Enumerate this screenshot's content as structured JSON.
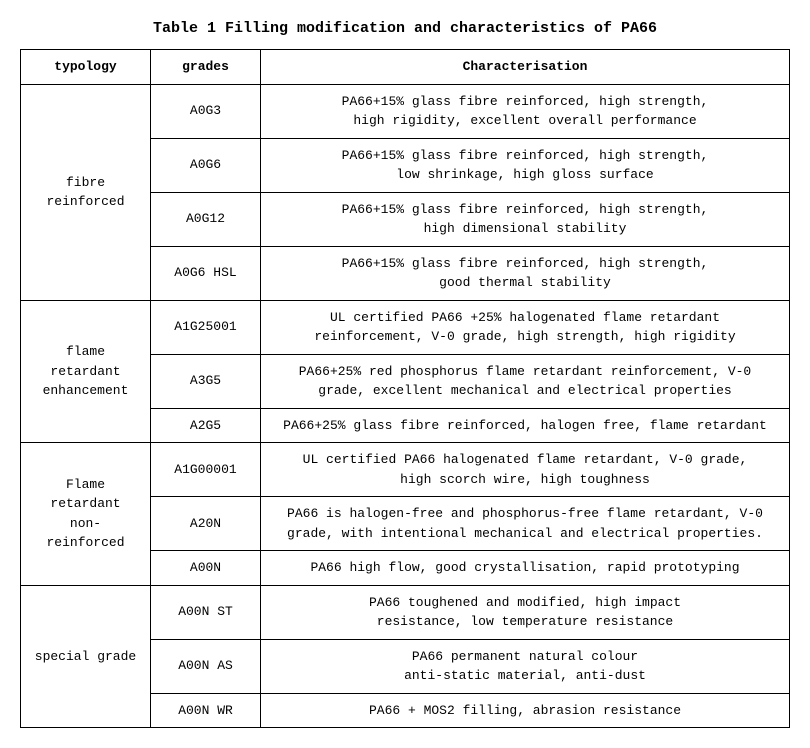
{
  "title": "Table 1 Filling modification and characteristics of PA66",
  "headers": {
    "typology": "typology",
    "grades": "grades",
    "characterisation": "Characterisation"
  },
  "sections": [
    {
      "typology": "fibre reinforced",
      "rowspan": 4,
      "rows": [
        {
          "grade": "A0G3",
          "char": "PA66+15% glass fibre reinforced, high strength,\nhigh rigidity, excellent overall performance"
        },
        {
          "grade": "A0G6",
          "char": "PA66+15% glass fibre reinforced, high strength,\nlow shrinkage, high gloss surface"
        },
        {
          "grade": "A0G12",
          "char": "PA66+15% glass fibre reinforced, high strength,\nhigh dimensional stability"
        },
        {
          "grade": "A0G6 HSL",
          "char": "PA66+15% glass fibre reinforced, high strength,\ngood thermal stability"
        }
      ]
    },
    {
      "typology": "flame retardant\nenhancement",
      "rowspan": 3,
      "rows": [
        {
          "grade": "A1G25001",
          "char": "UL certified PA66 +25% halogenated flame retardant\nreinforcement, V-0 grade, high strength, high rigidity"
        },
        {
          "grade": "A3G5",
          "char": "PA66+25% red phosphorus flame retardant reinforcement, V-0\ngrade, excellent mechanical and electrical properties"
        },
        {
          "grade": "A2G5",
          "char": "PA66+25% glass fibre reinforced, halogen free, flame retardant"
        }
      ]
    },
    {
      "typology": "Flame retardant\nnon-reinforced",
      "rowspan": 3,
      "rows": [
        {
          "grade": "A1G00001",
          "char": "UL certified PA66 halogenated flame retardant, V-0 grade,\nhigh scorch wire, high toughness"
        },
        {
          "grade": "A20N",
          "char": "PA66 is halogen-free and phosphorus-free flame retardant, V-0\ngrade, with intentional mechanical and electrical properties."
        },
        {
          "grade": "A00N",
          "char": "PA66 high flow, good crystallisation, rapid prototyping"
        }
      ]
    },
    {
      "typology": "special grade",
      "rowspan": 3,
      "rows": [
        {
          "grade": "A00N ST",
          "char": "PA66 toughened and modified, high impact\nresistance, low temperature resistance"
        },
        {
          "grade": "A00N AS",
          "char": "PA66 permanent natural colour\nanti-static material, anti-dust"
        },
        {
          "grade": "A00N WR",
          "char": "PA66 + MOS2 filling, abrasion resistance"
        }
      ]
    }
  ]
}
